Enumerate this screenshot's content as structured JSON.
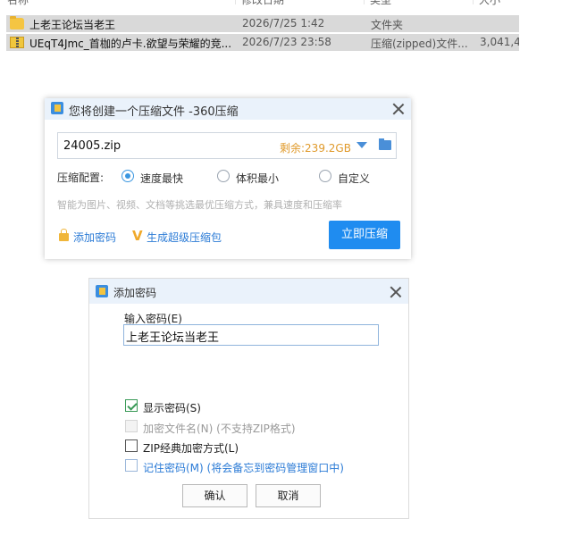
{
  "explorer": {
    "headers": [
      "名称",
      "修改日期",
      "类型",
      "大小"
    ],
    "rows": [
      {
        "name": "上老王论坛当老王",
        "date": "2026/7/25 1:42",
        "type": "文件夹",
        "size": "",
        "icon": "folder-icon"
      },
      {
        "name": "UEqT4Jmc_首枷的卢卡.欲望与荣耀的竞...",
        "date": "2026/7/23 23:58",
        "type": "压缩(zipped)文件...",
        "size": "3,041,4",
        "icon": "zip-file-icon"
      }
    ]
  },
  "compress_dialog": {
    "title": "您将创建一个压缩文件 -360压缩",
    "filename": "24005.zip",
    "free_space": "剩余:239.2GB",
    "config_label": "压缩配置:",
    "options": [
      "速度最快",
      "体积最小",
      "自定义"
    ],
    "selected_option": "速度最快",
    "hint": "智能为图片、视频、文档等挑选最优压缩方式，兼具速度和压缩率",
    "add_password": "添加密码",
    "super_package": "生成超级压缩包",
    "compress_now": "立即压缩",
    "accent_color": "#1f8cf0",
    "free_space_color": "#e09a2b"
  },
  "password_dialog": {
    "title": "添加密码",
    "input_label": "输入密码(E)",
    "password_value": "上老王论坛当老王",
    "checkboxes": [
      {
        "label": "显示密码(S)",
        "checked": true,
        "enabled": true
      },
      {
        "label": "加密文件名(N) (不支持ZIP格式)",
        "checked": false,
        "enabled": false
      },
      {
        "label": "ZIP经典加密方式(L)",
        "checked": false,
        "enabled": true
      },
      {
        "label": "记住密码(M) (将会备忘到密码管理窗口中)",
        "checked": false,
        "enabled": true
      }
    ],
    "ok": "确认",
    "cancel": "取消",
    "link_color": "#2b7bd6"
  }
}
